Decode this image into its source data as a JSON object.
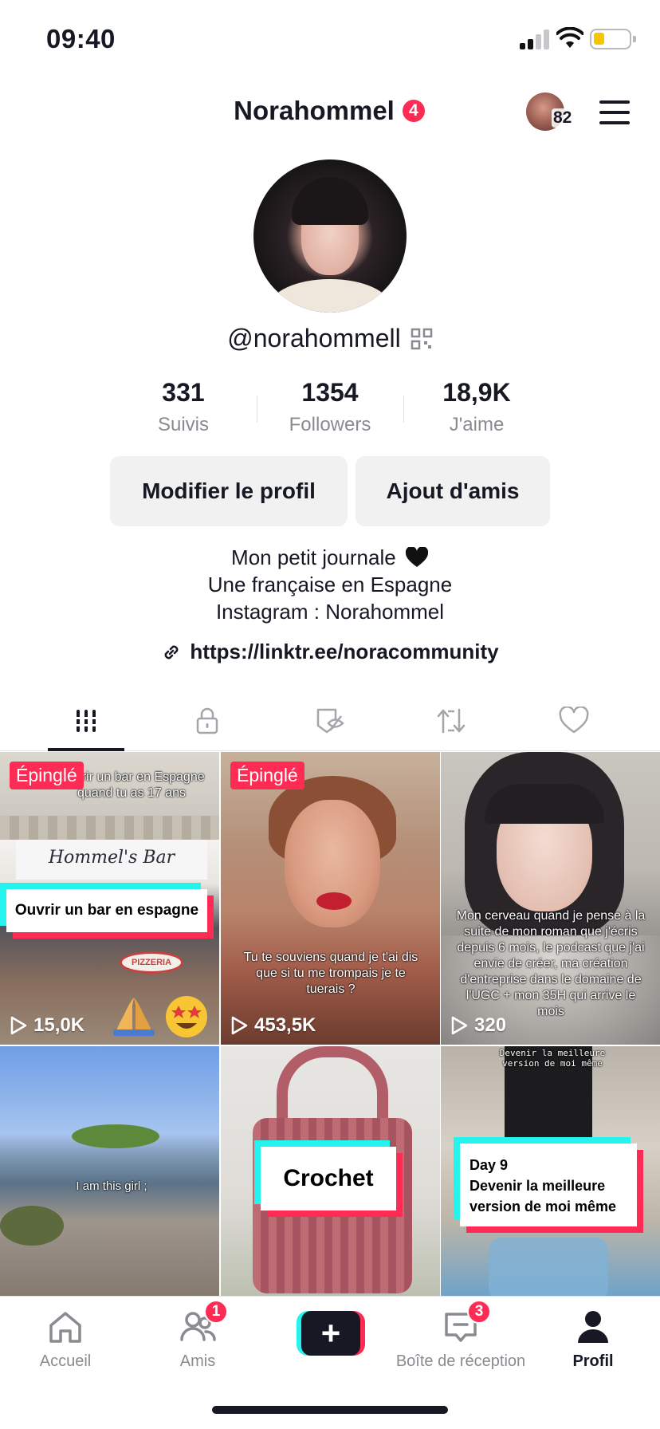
{
  "status_bar": {
    "time": "09:40"
  },
  "header": {
    "title": "Norahommel",
    "notification_count": "4",
    "story_count": "82"
  },
  "profile": {
    "username": "@norahommell",
    "stats": [
      {
        "value": "331",
        "label": "Suivis"
      },
      {
        "value": "1354",
        "label": "Followers"
      },
      {
        "value": "18,9K",
        "label": "J'aime"
      }
    ],
    "buttons": {
      "edit": "Modifier le profil",
      "add_friends": "Ajout d'amis"
    },
    "bio": [
      "Mon petit journale",
      "Une française en Espagne",
      "Instagram : Norahommel"
    ],
    "link": "https://linktr.ee/noracommunity"
  },
  "tabs": [
    {
      "icon": "videos-grid-icon"
    },
    {
      "icon": "private-lock-icon"
    },
    {
      "icon": "favorites-hidden-icon"
    },
    {
      "icon": "repost-icon"
    },
    {
      "icon": "liked-heart-icon"
    }
  ],
  "videos": [
    {
      "pinned": "Épinglé",
      "top_caption": "Ouvrir un bar en Espagne quand tu as 17 ans",
      "card_text": "Ouvrir un bar en espagne",
      "views": "15,0K"
    },
    {
      "pinned": "Épinglé",
      "caption": "Tu te souviens quand je t'ai dis que si tu me trompais je te tuerais ?",
      "views": "453,5K"
    },
    {
      "caption": "Mon cerveau quand je pense à la suite de mon roman que j'écris depuis 6 mois, le podcast que j'ai envie de créer, ma création d'entreprise dans le domaine de l'UGC + mon 35H qui arrive le mois",
      "views": "320"
    },
    {
      "caption": "I am this girl ;"
    },
    {
      "card_text": "Crochet"
    },
    {
      "top_caption": "Devenir la meilleure version de moi même",
      "card_line1": "Day 9",
      "card_line2": "Devenir la meilleure",
      "card_line3": "version de moi même"
    }
  ],
  "bottom_nav": {
    "home": "Accueil",
    "friends": "Amis",
    "friends_badge": "1",
    "inbox": "Boîte de réception",
    "inbox_badge": "3",
    "profile": "Profil",
    "create": "+"
  },
  "colors": {
    "accent_red": "#fe2c55",
    "accent_cyan": "#25f4ee",
    "text": "#161823",
    "muted": "#8a8b91"
  }
}
